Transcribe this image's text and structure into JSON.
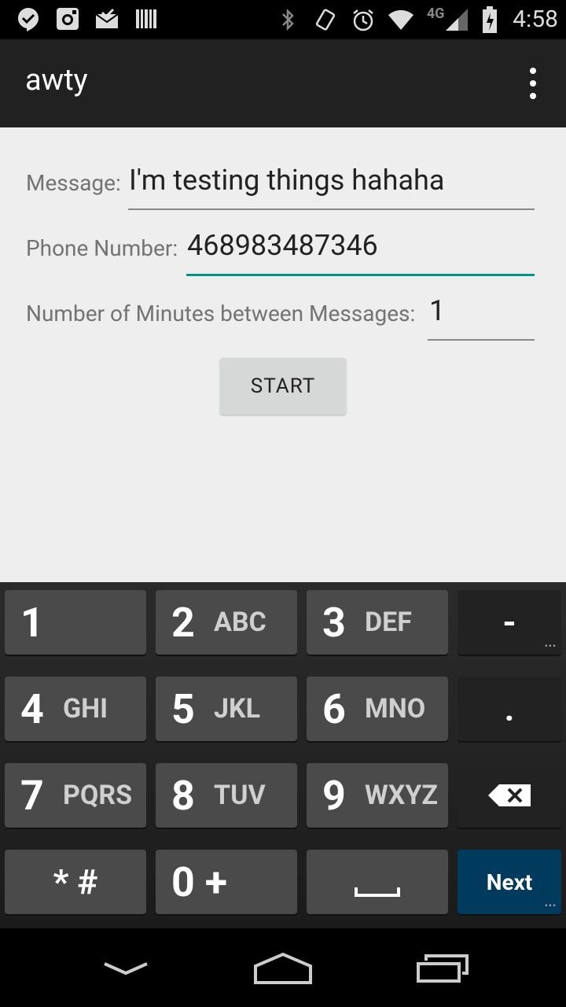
{
  "status_bar": {
    "time": "4:58",
    "network_label": "4G",
    "icons_left": [
      "hangouts-icon",
      "instagram-icon",
      "mail-icon",
      "barcode-icon"
    ],
    "icons_right": [
      "bluetooth-icon",
      "vibrate-icon",
      "alarm-icon",
      "wifi-icon",
      "signal-icon",
      "battery-icon"
    ]
  },
  "action_bar": {
    "title": "awty",
    "menu_icon": "overflow-menu-icon"
  },
  "form": {
    "message_label": "Message:",
    "message_value": "I'm testing things hahaha",
    "phone_label": "Phone Number:",
    "phone_value": "468983487346",
    "minutes_label": "Number of Minutes between Messages:",
    "minutes_value": "1",
    "start_button": "START"
  },
  "keyboard": {
    "rows": [
      [
        {
          "num": "1",
          "letters": ""
        },
        {
          "num": "2",
          "letters": "ABC"
        },
        {
          "num": "3",
          "letters": "DEF"
        },
        {
          "special": "-"
        }
      ],
      [
        {
          "num": "4",
          "letters": "GHI"
        },
        {
          "num": "5",
          "letters": "JKL"
        },
        {
          "num": "6",
          "letters": "MNO"
        },
        {
          "special": "."
        }
      ],
      [
        {
          "num": "7",
          "letters": "PQRS"
        },
        {
          "num": "8",
          "letters": "TUV"
        },
        {
          "num": "9",
          "letters": "WXYZ"
        },
        {
          "special": "backspace"
        }
      ],
      [
        {
          "label": "* #"
        },
        {
          "label": "0 +"
        },
        {
          "label": "space"
        },
        {
          "label": "Next"
        }
      ]
    ]
  }
}
